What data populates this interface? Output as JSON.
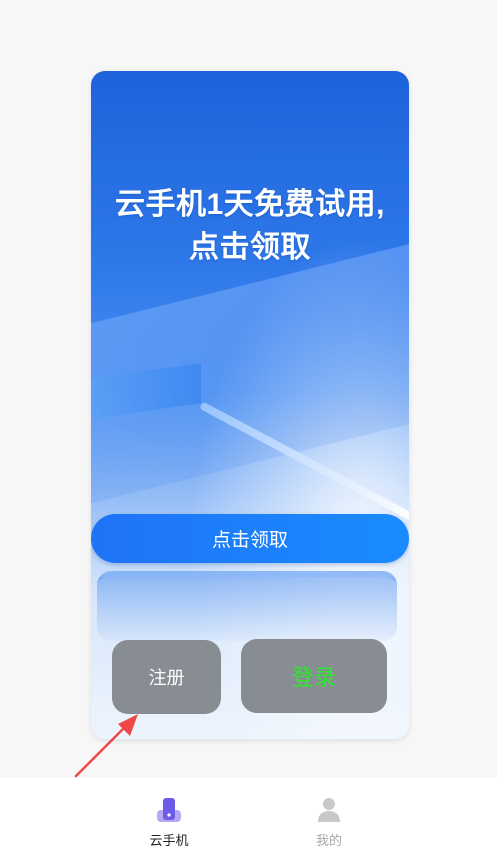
{
  "promo": {
    "headline_line1": "云手机1天免费试用,",
    "headline_line2": "点击领取",
    "claim_button_label": "点击领取"
  },
  "actions": {
    "register_label": "注册",
    "login_label": "登录"
  },
  "bottom_nav": {
    "items": [
      {
        "label": "云手机",
        "icon": "phone-icon",
        "active": true
      },
      {
        "label": "我的",
        "icon": "person-icon",
        "active": false
      }
    ]
  },
  "colors": {
    "accent_blue": "#1f73f5",
    "active_icon": "#6c5ce7",
    "inactive_icon": "#c9c9c9",
    "login_text": "#2ee82e",
    "overlay_button": "#888c93",
    "annotation_arrow": "#f04848"
  }
}
